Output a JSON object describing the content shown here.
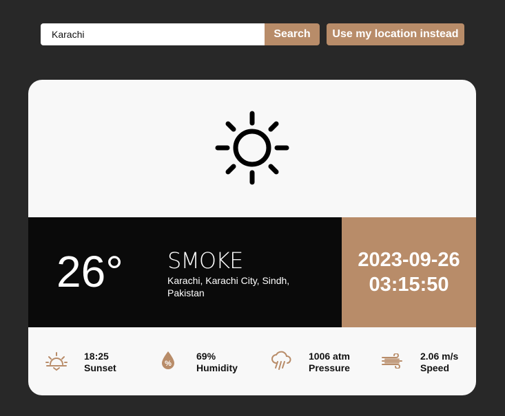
{
  "search": {
    "value": "Karachi",
    "button_label": "Search"
  },
  "location_button_label": "Use my location instead",
  "weather": {
    "icon": "sun-icon",
    "temperature": "26°",
    "condition": "SMOKE",
    "location": "Karachi, Karachi City, Sindh, Pakistan",
    "date": "2023-09-26",
    "time": "03:15:50"
  },
  "stats": [
    {
      "icon": "sunset-icon",
      "value": "18:25",
      "label": "Sunset"
    },
    {
      "icon": "humidity-drop-icon",
      "value": "69%",
      "label": "Humidity"
    },
    {
      "icon": "rain-cloud-icon",
      "value": "1006 atm",
      "label": "Pressure"
    },
    {
      "icon": "wind-icon",
      "value": "2.06 m/s",
      "label": "Speed"
    }
  ],
  "colors": {
    "accent": "#b88c69",
    "background": "#282828",
    "card": "#f8f8f8",
    "dark_panel": "#0a0a0a"
  }
}
